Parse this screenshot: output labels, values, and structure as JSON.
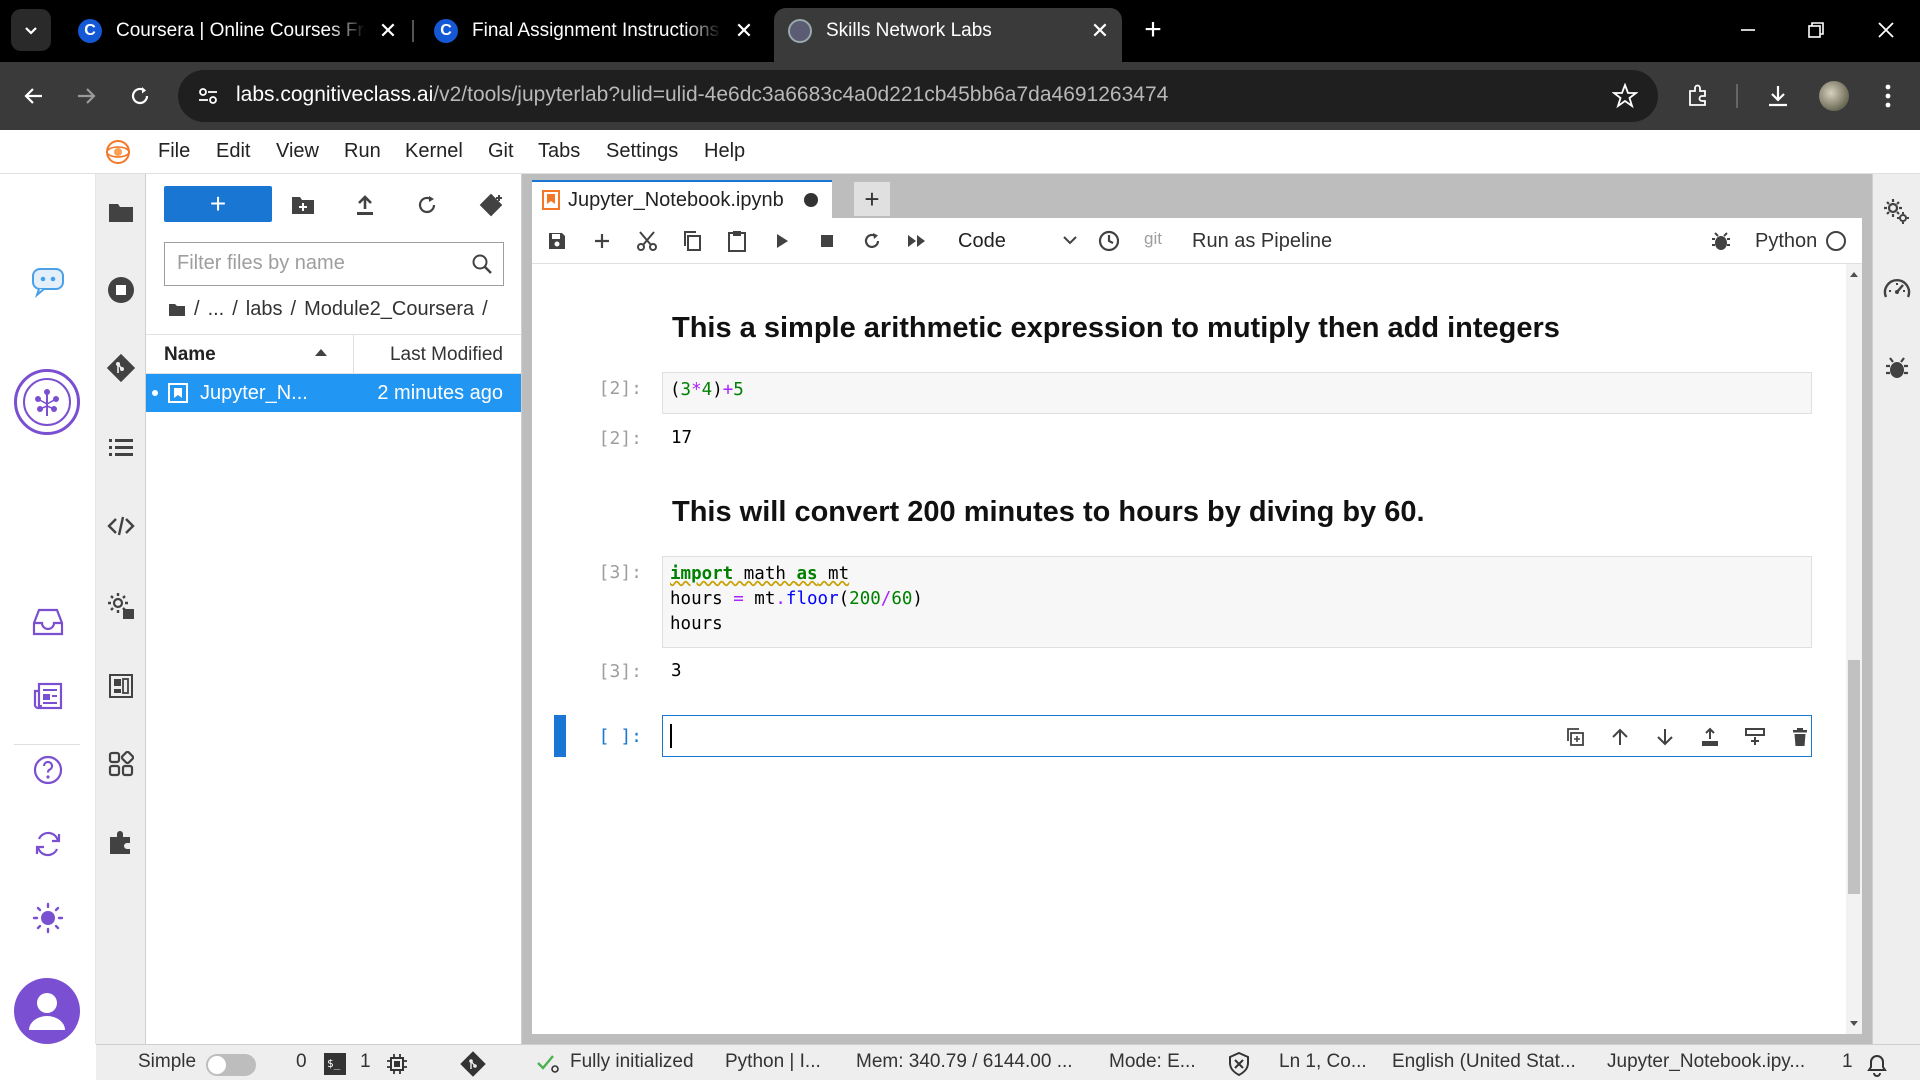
{
  "browser": {
    "tabs": [
      {
        "title": "Coursera | Online Courses From",
        "favicon": "C"
      },
      {
        "title": "Final Assignment Instructions: C",
        "favicon": "C"
      },
      {
        "title": "Skills Network Labs",
        "favicon": "skills"
      }
    ],
    "url_host": "labs.cognitiveclass.ai",
    "url_rest": "/v2/tools/jupyterlab?ulid=ulid-4e6dc3a6683c4a0d221cb45bb6a7da4691263474"
  },
  "menubar": {
    "items": [
      "File",
      "Edit",
      "View",
      "Run",
      "Kernel",
      "Git",
      "Tabs",
      "Settings",
      "Help"
    ]
  },
  "filebrowser": {
    "new_label": "+",
    "filter_placeholder": "Filter files by name",
    "breadcrumb_ellipsis": "...",
    "breadcrumb_sep": "/",
    "breadcrumb_path": "labs",
    "breadcrumb_folder": "Module2_Coursera",
    "col_name": "Name",
    "col_modified": "Last Modified",
    "file": {
      "name": "Jupyter_N...",
      "modified": "2 minutes ago"
    }
  },
  "notebook": {
    "tab_label": "Jupyter_Notebook.ipynb",
    "celltype": "Code",
    "git_label": "git",
    "pipeline_label": "Run as Pipeline",
    "kernel_name": "Python",
    "cells": {
      "md1": "This a simple arithmetic expression to mutiply then add integers",
      "prompt2_in": "[2]:",
      "prompt2_out": "[2]:",
      "out2": "17",
      "md2": "This will convert 200 minutes to hours by diving by 60.",
      "prompt3_in": "[3]:",
      "prompt3_out": "[3]:",
      "out3": "3",
      "prompt_empty": "[ ]:"
    }
  },
  "statusbar": {
    "simple_label": "Simple",
    "count0": "0",
    "count1": "1",
    "status": "Fully initialized",
    "kernel": "Python | I...",
    "mem": "Mem: 340.79 / 6144.00 ...",
    "mode": "Mode: E...",
    "pos": "Ln 1, Co...",
    "lang": "English (United Stat...",
    "file": "Jupyter_Notebook.ipy...",
    "notif": "1"
  },
  "colors": {
    "accent": "#1976d2",
    "selected_row": "#2196f3",
    "rail_icon": "#7b4fd1"
  }
}
